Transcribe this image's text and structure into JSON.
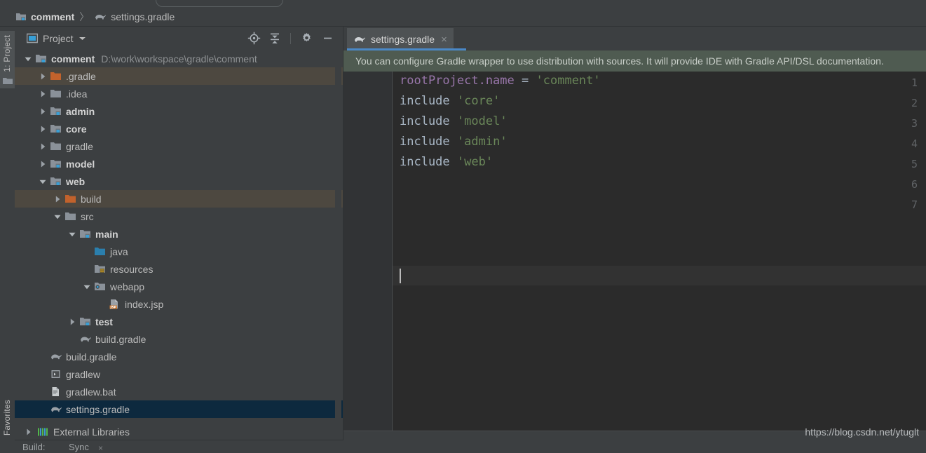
{
  "breadcrumb": {
    "project": "comment",
    "separator": "〉",
    "file": "settings.gradle"
  },
  "left_strip": {
    "project_tab": "1: Project",
    "favorites_tab": "Favorites"
  },
  "project_toolbar": {
    "title": "Project",
    "icons": [
      "locate-icon",
      "collapse-all-icon",
      "gear-icon",
      "minimize-icon"
    ]
  },
  "tree": {
    "items": [
      {
        "label": "comment",
        "path": "D:\\work\\workspace\\gradle\\comment",
        "indent": 0,
        "twisty": "down",
        "icon": "module-folder-icon",
        "bold": true,
        "selected": "none"
      },
      {
        "label": ".gradle",
        "path": "",
        "indent": 1,
        "twisty": "right",
        "icon": "excluded-folder-icon",
        "bold": false,
        "selected": "olive"
      },
      {
        "label": ".idea",
        "path": "",
        "indent": 1,
        "twisty": "right",
        "icon": "folder-icon",
        "bold": false,
        "selected": "none"
      },
      {
        "label": "admin",
        "path": "",
        "indent": 1,
        "twisty": "right",
        "icon": "module-folder-icon",
        "bold": true,
        "selected": "none"
      },
      {
        "label": "core",
        "path": "",
        "indent": 1,
        "twisty": "right",
        "icon": "module-folder-icon",
        "bold": true,
        "selected": "none"
      },
      {
        "label": "gradle",
        "path": "",
        "indent": 1,
        "twisty": "right",
        "icon": "folder-icon",
        "bold": false,
        "selected": "none"
      },
      {
        "label": "model",
        "path": "",
        "indent": 1,
        "twisty": "right",
        "icon": "module-folder-icon",
        "bold": true,
        "selected": "none"
      },
      {
        "label": "web",
        "path": "",
        "indent": 1,
        "twisty": "down",
        "icon": "module-folder-icon",
        "bold": true,
        "selected": "none"
      },
      {
        "label": "build",
        "path": "",
        "indent": 2,
        "twisty": "right",
        "icon": "excluded-folder-icon",
        "bold": false,
        "selected": "olive"
      },
      {
        "label": "src",
        "path": "",
        "indent": 2,
        "twisty": "down",
        "icon": "folder-icon",
        "bold": false,
        "selected": "none"
      },
      {
        "label": "main",
        "path": "",
        "indent": 3,
        "twisty": "down",
        "icon": "module-folder-icon",
        "bold": true,
        "selected": "none"
      },
      {
        "label": "java",
        "path": "",
        "indent": 4,
        "twisty": "none",
        "icon": "source-root-icon",
        "bold": false,
        "selected": "none"
      },
      {
        "label": "resources",
        "path": "",
        "indent": 4,
        "twisty": "none",
        "icon": "resources-root-icon",
        "bold": false,
        "selected": "none"
      },
      {
        "label": "webapp",
        "path": "",
        "indent": 4,
        "twisty": "down",
        "icon": "webapp-folder-icon",
        "bold": false,
        "selected": "none"
      },
      {
        "label": "index.jsp",
        "path": "",
        "indent": 5,
        "twisty": "none",
        "icon": "jsp-file-icon",
        "bold": false,
        "selected": "none"
      },
      {
        "label": "test",
        "path": "",
        "indent": 3,
        "twisty": "right",
        "icon": "module-folder-icon",
        "bold": true,
        "selected": "none"
      },
      {
        "label": "build.gradle",
        "path": "",
        "indent": 3,
        "twisty": "none",
        "icon": "gradle-file-icon",
        "bold": false,
        "selected": "none"
      },
      {
        "label": "build.gradle",
        "path": "",
        "indent": 1,
        "twisty": "none",
        "icon": "gradle-file-icon",
        "bold": false,
        "selected": "none"
      },
      {
        "label": "gradlew",
        "path": "",
        "indent": 1,
        "twisty": "none",
        "icon": "script-file-icon",
        "bold": false,
        "selected": "none"
      },
      {
        "label": "gradlew.bat",
        "path": "",
        "indent": 1,
        "twisty": "none",
        "icon": "bat-file-icon",
        "bold": false,
        "selected": "none"
      },
      {
        "label": "settings.gradle",
        "path": "",
        "indent": 1,
        "twisty": "none",
        "icon": "gradle-file-icon",
        "bold": false,
        "selected": "blue"
      }
    ],
    "external_libraries": "External Libraries"
  },
  "editor": {
    "tab_label": "settings.gradle",
    "tab_close": "×",
    "banner": "You can configure Gradle wrapper to use distribution with sources. It will provide IDE with Gradle API/DSL documentation.",
    "line_numbers": [
      "1",
      "2",
      "3",
      "4",
      "5",
      "6",
      "7"
    ],
    "code_lines": [
      {
        "tokens": [
          {
            "t": "rootProject.name",
            "c": "prop"
          },
          {
            "t": " ",
            "c": "id"
          },
          {
            "t": "=",
            "c": "op"
          },
          {
            "t": " ",
            "c": "id"
          },
          {
            "t": "'comment'",
            "c": "str"
          }
        ]
      },
      {
        "tokens": [
          {
            "t": "include",
            "c": "id"
          },
          {
            "t": " ",
            "c": "id"
          },
          {
            "t": "'core'",
            "c": "str"
          }
        ]
      },
      {
        "tokens": [
          {
            "t": "include",
            "c": "id"
          },
          {
            "t": " ",
            "c": "id"
          },
          {
            "t": "'model'",
            "c": "str"
          }
        ]
      },
      {
        "tokens": [
          {
            "t": "include",
            "c": "id"
          },
          {
            "t": " ",
            "c": "id"
          },
          {
            "t": "'admin'",
            "c": "str"
          }
        ]
      },
      {
        "tokens": [
          {
            "t": "include",
            "c": "id"
          },
          {
            "t": " ",
            "c": "id"
          },
          {
            "t": "'web'",
            "c": "str"
          }
        ]
      },
      {
        "tokens": []
      },
      {
        "tokens": []
      }
    ]
  },
  "status_bar": {
    "build_label": "Build:",
    "sync_label": "Sync",
    "sync_close": "×"
  },
  "watermark": "https://blog.csdn.net/ytuglt",
  "colors": {
    "panel_bg": "#3c3f41",
    "editor_bg": "#2b2b2b",
    "gutter_bg": "#313335",
    "selection_blue": "#0d293e",
    "selection_olive": "#4d4840",
    "tab_accent": "#4a88c7",
    "banner_bg": "#4f5b51",
    "string_green": "#6a8759",
    "property_purple": "#9876aa",
    "text": "#bbbbbb"
  }
}
